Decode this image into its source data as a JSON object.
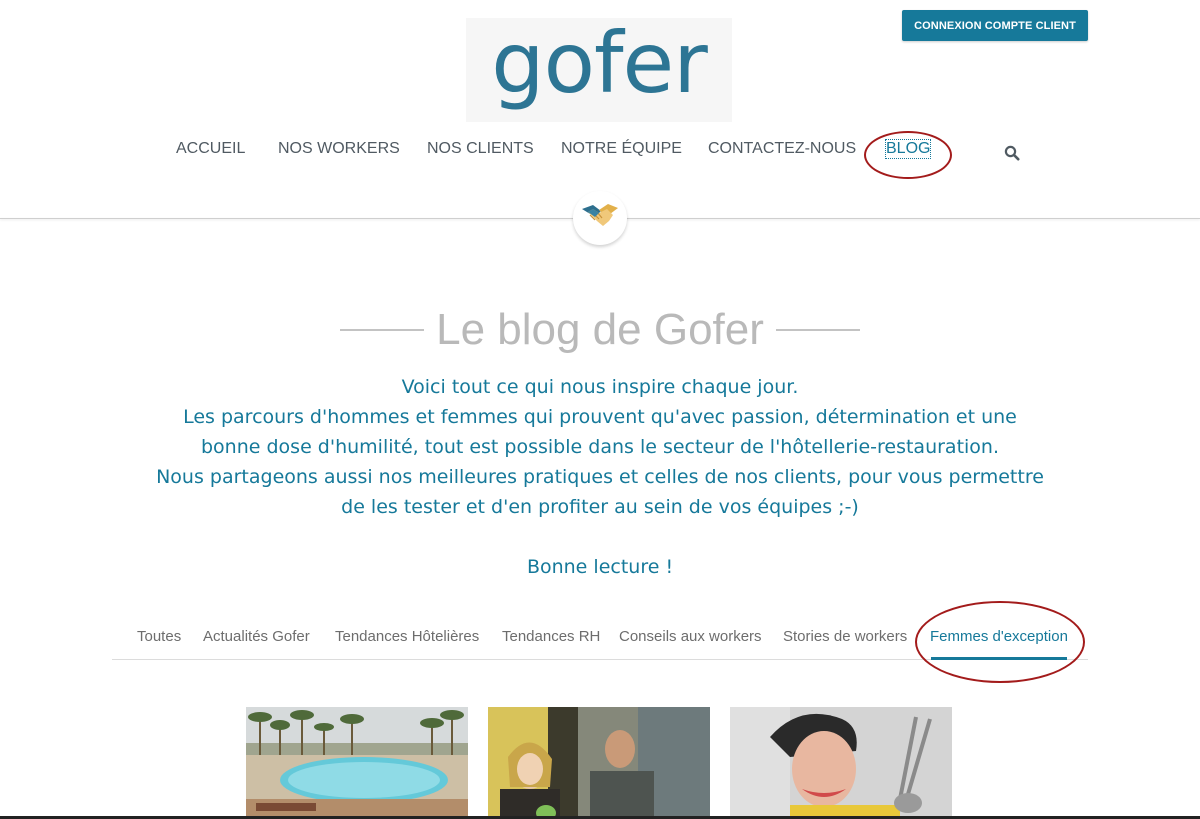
{
  "header": {
    "client_button": "CONNEXION COMPTE CLIENT",
    "logo_text": "gofer"
  },
  "nav": {
    "items": [
      "ACCUEIL",
      "NOS WORKERS",
      "NOS CLIENTS",
      "NOTRE ÉQUIPE",
      "CONTACTEZ-NOUS",
      "BLOG"
    ],
    "active": "BLOG"
  },
  "page": {
    "title": "Le blog de Gofer",
    "intro_lines": [
      "Voici tout ce qui nous inspire chaque jour.",
      "Les parcours d'hommes et femmes qui prouvent qu'avec passion, détermination et une",
      "bonne dose d'humilité, tout est possible dans le secteur de l'hôtellerie-restauration.",
      "Nous partageons aussi nos meilleures pratiques et celles de nos clients, pour vous permettre",
      "de les tester et d'en profiter au sein de vos équipes ;-)"
    ],
    "closing": "Bonne lecture !"
  },
  "tabs": {
    "items": [
      "Toutes",
      "Actualités Gofer",
      "Tendances Hôtelières",
      "Tendances RH",
      "Conseils aux workers",
      "Stories de workers",
      "Femmes d'exception"
    ],
    "active": "Femmes d'exception"
  },
  "icons": {
    "search": "search-icon",
    "badge": "handshake-icon"
  },
  "colors": {
    "accent": "#16799a",
    "annotation": "#a31b1b",
    "title_gray": "#b9b9b9"
  }
}
